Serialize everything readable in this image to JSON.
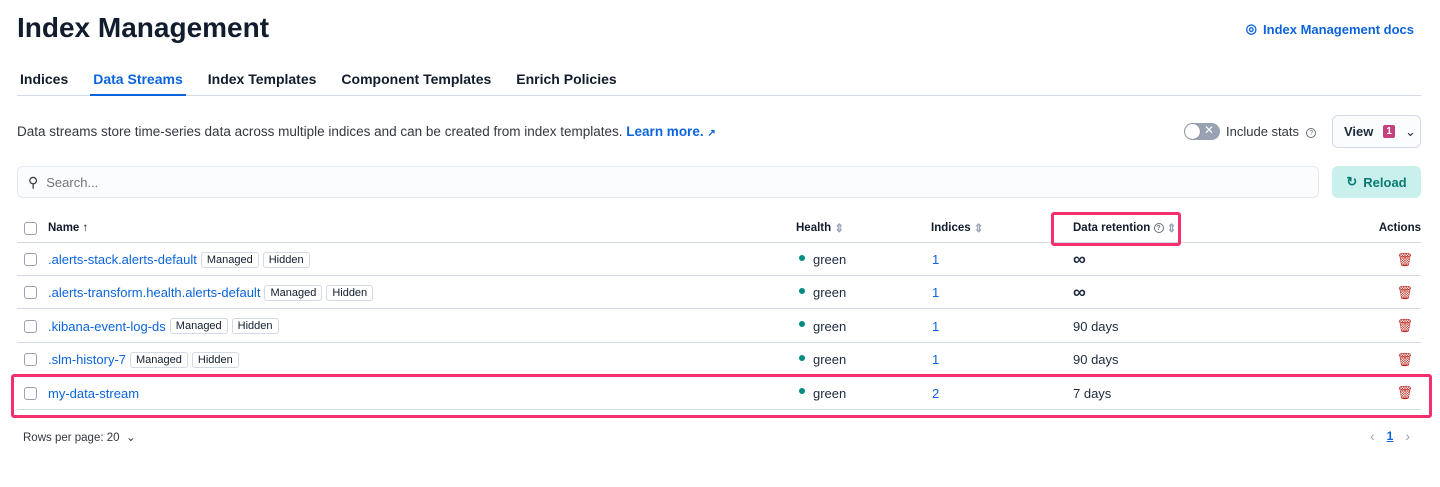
{
  "title": "Index Management",
  "docs_link": "Index Management docs",
  "tabs": [
    "Indices",
    "Data Streams",
    "Index Templates",
    "Component Templates",
    "Enrich Policies"
  ],
  "description": "Data streams store time-series data across multiple indices and can be created from index templates.",
  "learn_more": "Learn more.",
  "include_stats": "Include stats",
  "view": {
    "label": "View",
    "badge": "1"
  },
  "search": {
    "placeholder": "Search...",
    "value": ""
  },
  "reload": "Reload",
  "columns": {
    "name": "Name",
    "health": "Health",
    "indices": "Indices",
    "retention": "Data retention",
    "actions": "Actions"
  },
  "rows": [
    {
      "name": ".alerts-stack.alerts-default",
      "tags": [
        "Managed",
        "Hidden"
      ],
      "health": "green",
      "indices": "1",
      "retention": "∞"
    },
    {
      "name": ".alerts-transform.health.alerts-default",
      "tags": [
        "Managed",
        "Hidden"
      ],
      "health": "green",
      "indices": "1",
      "retention": "∞"
    },
    {
      "name": ".kibana-event-log-ds",
      "tags": [
        "Managed",
        "Hidden"
      ],
      "health": "green",
      "indices": "1",
      "retention": "90 days"
    },
    {
      "name": ".slm-history-7",
      "tags": [
        "Managed",
        "Hidden"
      ],
      "health": "green",
      "indices": "1",
      "retention": "90 days"
    },
    {
      "name": "my-data-stream",
      "tags": [],
      "health": "green",
      "indices": "2",
      "retention": "7 days"
    }
  ],
  "pagination": {
    "rows_per_page": "Rows per page: 20",
    "current_page": "1"
  }
}
